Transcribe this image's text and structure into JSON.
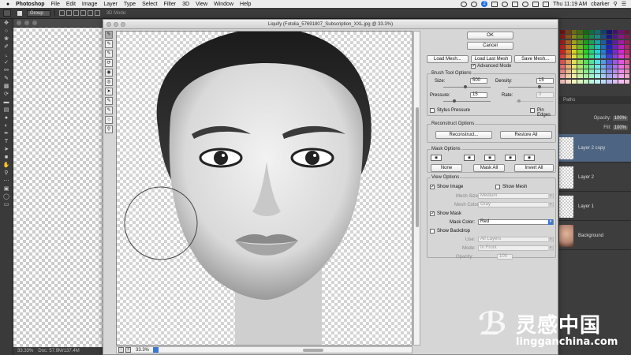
{
  "menubar": {
    "app": "Photoshop",
    "items": [
      "File",
      "Edit",
      "Image",
      "Layer",
      "Type",
      "Select",
      "Filter",
      "3D",
      "View",
      "Window",
      "Help"
    ],
    "clock": "Thu 11:19 AM",
    "user": "cbarker",
    "badge": "2"
  },
  "optionsbar": {
    "group_select": "Group",
    "mode_3d": "3D Mode:"
  },
  "toolbar": {
    "tools": [
      "move-tool",
      "marquee-tool",
      "lasso-tool",
      "quick-select-tool",
      "crop-tool",
      "eyedropper-tool",
      "healing-tool",
      "brush-tool",
      "clone-stamp-tool",
      "history-brush-tool",
      "eraser-tool",
      "gradient-tool",
      "blur-tool",
      "dodge-tool",
      "pen-tool",
      "type-tool",
      "path-select-tool",
      "shape-tool",
      "hand-tool",
      "zoom-tool"
    ]
  },
  "status": {
    "zoom": "33.33%",
    "doc": "Doc: 57.9M/137.4M"
  },
  "right_panels": {
    "tabs": [
      "Paths"
    ],
    "opacity_label": "Opacity:",
    "opacity_value": "100%",
    "fill_label": "Fill:",
    "fill_value": "100%",
    "layers": [
      "Layer 2 copy",
      "Layer 2",
      "Layer 1",
      "Background"
    ]
  },
  "dialog": {
    "title": "Liquify (Fotolia_57691807_Subscription_XXL.jpg @ 33.3%)",
    "ok": "OK",
    "cancel": "Cancel",
    "load_mesh": "Load Mesh...",
    "load_last_mesh": "Load Last Mesh",
    "save_mesh": "Save Mesh...",
    "advanced_mode": "Advanced Mode",
    "brush": {
      "title": "Brush Tool Options",
      "size_label": "Size:",
      "size_value": "500",
      "density_label": "Density:",
      "density_value": "15",
      "pressure_label": "Pressure:",
      "pressure_value": "15",
      "rate_label": "Rate:",
      "rate_value": "0",
      "stylus": "Stylus Pressure",
      "pin_edges": "Pin Edges"
    },
    "reconstruct": {
      "title": "Reconstruct Options",
      "reconstruct": "Reconstruct...",
      "restore_all": "Restore All"
    },
    "mask": {
      "title": "Mask Options",
      "none": "None",
      "mask_all": "Mask All",
      "invert_all": "Invert All"
    },
    "view": {
      "title": "View Options",
      "show_image": "Show Image",
      "show_mesh": "Show Mesh",
      "mesh_size_label": "Mesh Size:",
      "mesh_size_value": "Medium",
      "mesh_color_label": "Mesh Color:",
      "mesh_color_value": "Gray",
      "show_mask": "Show Mask",
      "mask_color_label": "Mask Color:",
      "mask_color_value": "Red",
      "show_backdrop": "Show Backdrop",
      "use_label": "Use:",
      "use_value": "All Layers",
      "mode_label": "Mode:",
      "mode_value": "In Front",
      "opacity_label": "Opacity:",
      "opacity_value": "100"
    },
    "zoom_value": "33.3%"
  },
  "watermark": {
    "cn": "灵感中国",
    "url": "lingganchina.com"
  }
}
